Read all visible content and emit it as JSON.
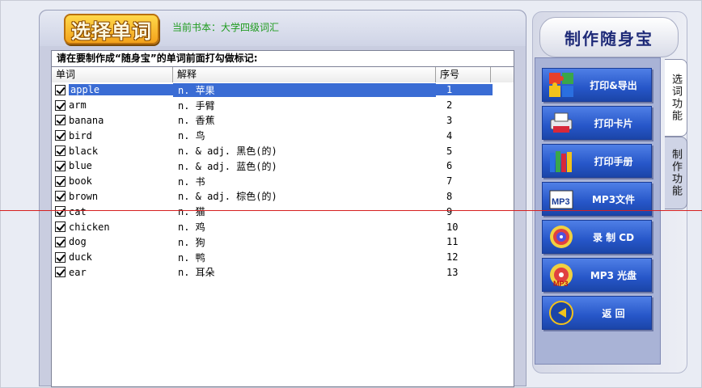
{
  "header": {
    "logo_text": "选择单词",
    "current_book": "当前书本：大学四级词汇"
  },
  "instruction": "请在要制作成“随身宝”的单词前面打勾做标记:",
  "columns": [
    "单词",
    "解释",
    "序号"
  ],
  "words": [
    {
      "word": "apple",
      "def": "n. 苹果",
      "num": "1",
      "checked": true,
      "selected": true
    },
    {
      "word": "arm",
      "def": "n. 手臂",
      "num": "2",
      "checked": true
    },
    {
      "word": "banana",
      "def": "n. 香蕉",
      "num": "3",
      "checked": true
    },
    {
      "word": "bird",
      "def": "n. 鸟",
      "num": "4",
      "checked": true
    },
    {
      "word": "black",
      "def": "n. & adj. 黑色(的)",
      "num": "5",
      "checked": true
    },
    {
      "word": "blue",
      "def": "n. & adj. 蓝色(的)",
      "num": "6",
      "checked": true
    },
    {
      "word": "book",
      "def": "n. 书",
      "num": "7",
      "checked": true
    },
    {
      "word": "brown",
      "def": "n. & adj. 棕色(的)",
      "num": "8",
      "checked": true
    },
    {
      "word": "cat",
      "def": "n. 猫",
      "num": "9",
      "checked": true
    },
    {
      "word": "chicken",
      "def": "n. 鸡",
      "num": "10",
      "checked": true
    },
    {
      "word": "dog",
      "def": "n. 狗",
      "num": "11",
      "checked": true
    },
    {
      "word": "duck",
      "def": "n. 鸭",
      "num": "12",
      "checked": true
    },
    {
      "word": "ear",
      "def": "n. 耳朵",
      "num": "13",
      "checked": true
    }
  ],
  "side": {
    "title": "制作随身宝",
    "buttons": [
      {
        "label": "打印&导出",
        "icon": "puzzle-icon"
      },
      {
        "label": "打印卡片",
        "icon": "printer-icon"
      },
      {
        "label": "打印手册",
        "icon": "books-icon"
      },
      {
        "label": "MP3文件",
        "icon": "mp3-icon"
      },
      {
        "label": "录 制 CD",
        "icon": "cd-icon"
      },
      {
        "label": "MP3 光盘",
        "icon": "mp3-cd-icon"
      },
      {
        "label": "返   回",
        "icon": "return-icon"
      }
    ],
    "tabs": [
      "选词功能",
      "制作功能"
    ]
  },
  "colors": {
    "selection": "#3a6cd4",
    "button_blue": "#2656c8",
    "book_green": "#1e9b1e"
  }
}
